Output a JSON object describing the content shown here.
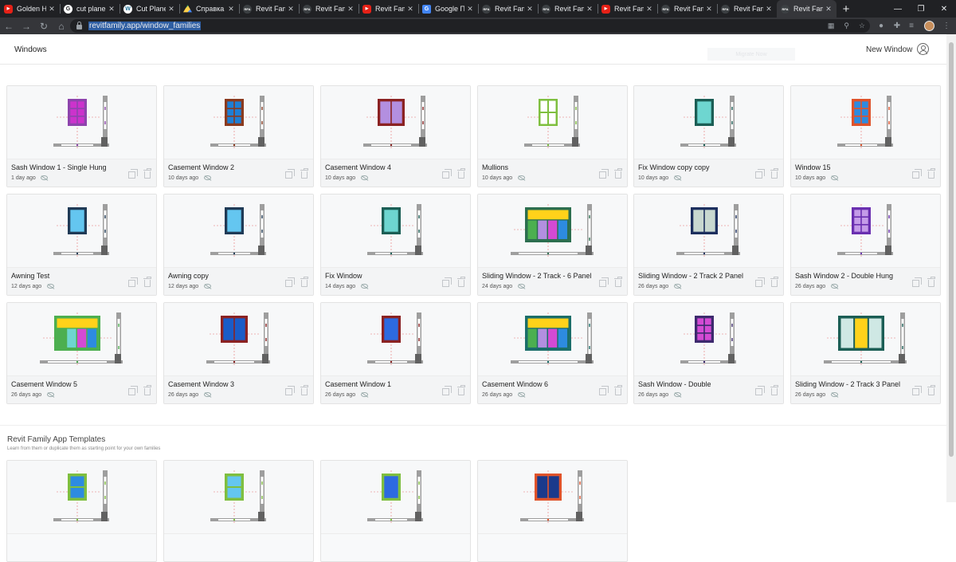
{
  "browser": {
    "tabs": [
      {
        "favicon": "youtube-icon",
        "title": "Golden Ho",
        "active": false
      },
      {
        "favicon": "google-icon",
        "title": "cut plane r",
        "active": false
      },
      {
        "favicon": "wordpress-icon",
        "title": "Cut Plane",
        "active": false
      },
      {
        "favicon": "drive-icon",
        "title": "Справка |",
        "active": false
      },
      {
        "favicon": "rfa-icon",
        "title": "Revit Fami",
        "active": false
      },
      {
        "favicon": "rfa-icon",
        "title": "Revit Fam",
        "active": false
      },
      {
        "favicon": "youtube-icon",
        "title": "Revit Fami",
        "active": false
      },
      {
        "favicon": "google-translate-icon",
        "title": "Google Пе",
        "active": false
      },
      {
        "favicon": "rfa-icon",
        "title": "Revit Fam",
        "active": false
      },
      {
        "favicon": "rfa-icon",
        "title": "Revit Fam",
        "active": false
      },
      {
        "favicon": "youtube-icon",
        "title": "Revit Fam",
        "active": false
      },
      {
        "favicon": "rfa-icon",
        "title": "Revit Fam",
        "active": false
      },
      {
        "favicon": "rfa-icon",
        "title": "Revit Fam",
        "active": false
      },
      {
        "favicon": "rfa-icon",
        "title": "Revit Fam",
        "active": true
      }
    ],
    "url": "revitfamily.app/window_families"
  },
  "header": {
    "title": "Windows",
    "ghost_button_label": "Migrate Now",
    "new_window_label": "New Window"
  },
  "families": [
    {
      "title": "Sash Window 1 - Single Hung",
      "date": "1 day ago",
      "thumb": {
        "frame": "#8e44ad",
        "glass": "#cc33cc",
        "style": "grid"
      }
    },
    {
      "title": "Casement Window 2",
      "date": "10 days ago",
      "thumb": {
        "frame": "#8b3a1e",
        "glass": "#1e7fd6",
        "style": "grid"
      }
    },
    {
      "title": "Casement Window 4",
      "date": "10 days ago",
      "thumb": {
        "frame": "#8b2222",
        "glass": "#b38fe0",
        "style": "duo"
      }
    },
    {
      "title": "Mullions",
      "date": "10 days ago",
      "thumb": {
        "frame": "#7fbf3f",
        "glass": "#ffffff",
        "style": "cross"
      }
    },
    {
      "title": "Fix Window copy copy",
      "date": "10 days ago",
      "thumb": {
        "frame": "#1b5e55",
        "glass": "#6ed6d0",
        "style": "single"
      }
    },
    {
      "title": "Window 15",
      "date": "10 days ago",
      "thumb": {
        "frame": "#e0532a",
        "glass": "#2d8be0",
        "style": "grid"
      }
    },
    {
      "title": "Awning Test",
      "date": "12 days ago",
      "thumb": {
        "frame": "#1f3a56",
        "glass": "#64c6f0",
        "style": "single"
      }
    },
    {
      "title": "Awning copy",
      "date": "12 days ago",
      "thumb": {
        "frame": "#1f3a56",
        "glass": "#64c6f0",
        "style": "single"
      }
    },
    {
      "title": "Fix Window",
      "date": "14 days ago",
      "thumb": {
        "frame": "#1b5e55",
        "glass": "#6ed6d0",
        "style": "single"
      }
    },
    {
      "title": "Sliding Window - 2 Track - 6 Panel",
      "date": "24 days ago",
      "thumb": {
        "frame": "#2c6e4f",
        "glass": "#b38fe0",
        "style": "panels"
      }
    },
    {
      "title": "Sliding Window - 2 Track 2 Panel",
      "date": "26 days ago",
      "thumb": {
        "frame": "#1c2f5e",
        "glass": "#c8d8d0",
        "style": "duo"
      }
    },
    {
      "title": "Sash Window 2 - Double Hung",
      "date": "26 days ago",
      "thumb": {
        "frame": "#6a2fb0",
        "glass": "#c49be8",
        "style": "grid"
      }
    },
    {
      "title": "Casement Window 5",
      "date": "26 days ago",
      "thumb": {
        "frame": "#4caf50",
        "glass": "#6ed6d0",
        "style": "panels"
      }
    },
    {
      "title": "Casement Window 3",
      "date": "26 days ago",
      "thumb": {
        "frame": "#8b2222",
        "glass": "#1a5cc8",
        "style": "duo"
      }
    },
    {
      "title": "Casement Window 1",
      "date": "26 days ago",
      "thumb": {
        "frame": "#8b2222",
        "glass": "#2d6ae0",
        "style": "single"
      }
    },
    {
      "title": "Casement Window 6",
      "date": "26 days ago",
      "thumb": {
        "frame": "#1b6e6a",
        "glass": "#b38fe0",
        "style": "panels"
      }
    },
    {
      "title": "Sash Window - Double",
      "date": "26 days ago",
      "thumb": {
        "frame": "#3d2a6e",
        "glass": "#d44ad4",
        "style": "grid"
      }
    },
    {
      "title": "Sliding Window - 2 Track 3 Panel",
      "date": "26 days ago",
      "thumb": {
        "frame": "#1b5e55",
        "glass": "#ffd21a",
        "style": "trio"
      }
    }
  ],
  "templates": {
    "heading": "Revit Family App Templates",
    "subheading": "Learn from them or duplicate them as starting point for your own families",
    "items": [
      {
        "thumb": {
          "frame": "#7fbf3f",
          "glass": "#2d8be0",
          "style": "stack"
        }
      },
      {
        "thumb": {
          "frame": "#7fbf3f",
          "glass": "#64c6f0",
          "style": "stack"
        }
      },
      {
        "thumb": {
          "frame": "#7fbf3f",
          "glass": "#2d6ae0",
          "style": "single"
        }
      },
      {
        "thumb": {
          "frame": "#e0532a",
          "glass": "#1a3a8c",
          "style": "duo"
        }
      }
    ]
  }
}
